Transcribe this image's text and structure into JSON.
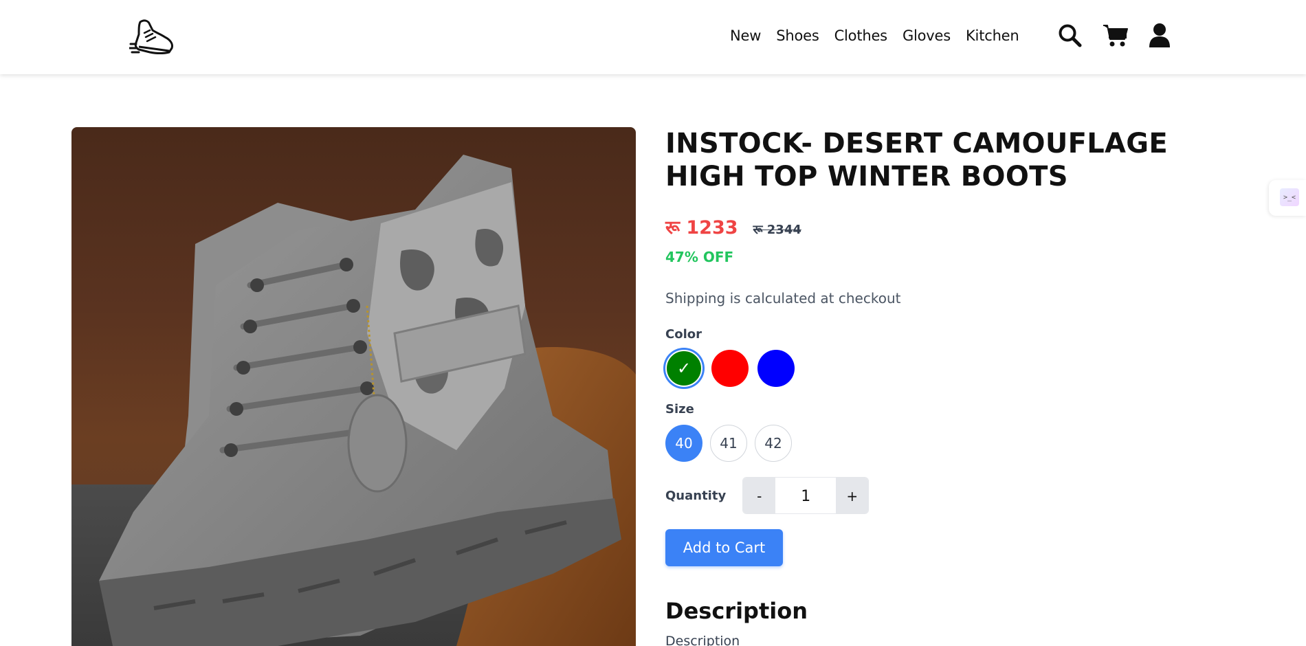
{
  "header": {
    "nav": [
      "New",
      "Shoes",
      "Clothes",
      "Gloves",
      "Kitchen"
    ]
  },
  "side_widget": {
    "text": ">_<"
  },
  "product": {
    "title": "INSTOCK- DESERT CAMOUFLAGE HIGH TOP WINTER BOOTS",
    "price": "रू 1233",
    "compare_price": "रू 2344",
    "discount": "47% OFF",
    "shipping_note": "Shipping is calculated at checkout",
    "color_label": "Color",
    "colors": [
      {
        "name": "green",
        "hex": "#008000",
        "selected": true,
        "mark": "✓"
      },
      {
        "name": "red",
        "hex": "#ff0000",
        "selected": false,
        "mark": ""
      },
      {
        "name": "blue",
        "hex": "#0000ff",
        "selected": false,
        "mark": ""
      }
    ],
    "size_label": "Size",
    "sizes": [
      "40",
      "41",
      "42"
    ],
    "selected_size": "40",
    "quantity_label": "Quantity",
    "quantity": "1",
    "decrement": "-",
    "increment": "+",
    "add_to_cart": "Add to Cart",
    "description_heading": "Description",
    "description_text": "Description"
  },
  "colors": {
    "accent": "#3b82f6",
    "price": "#ef4444",
    "discount": "#22c55e"
  }
}
